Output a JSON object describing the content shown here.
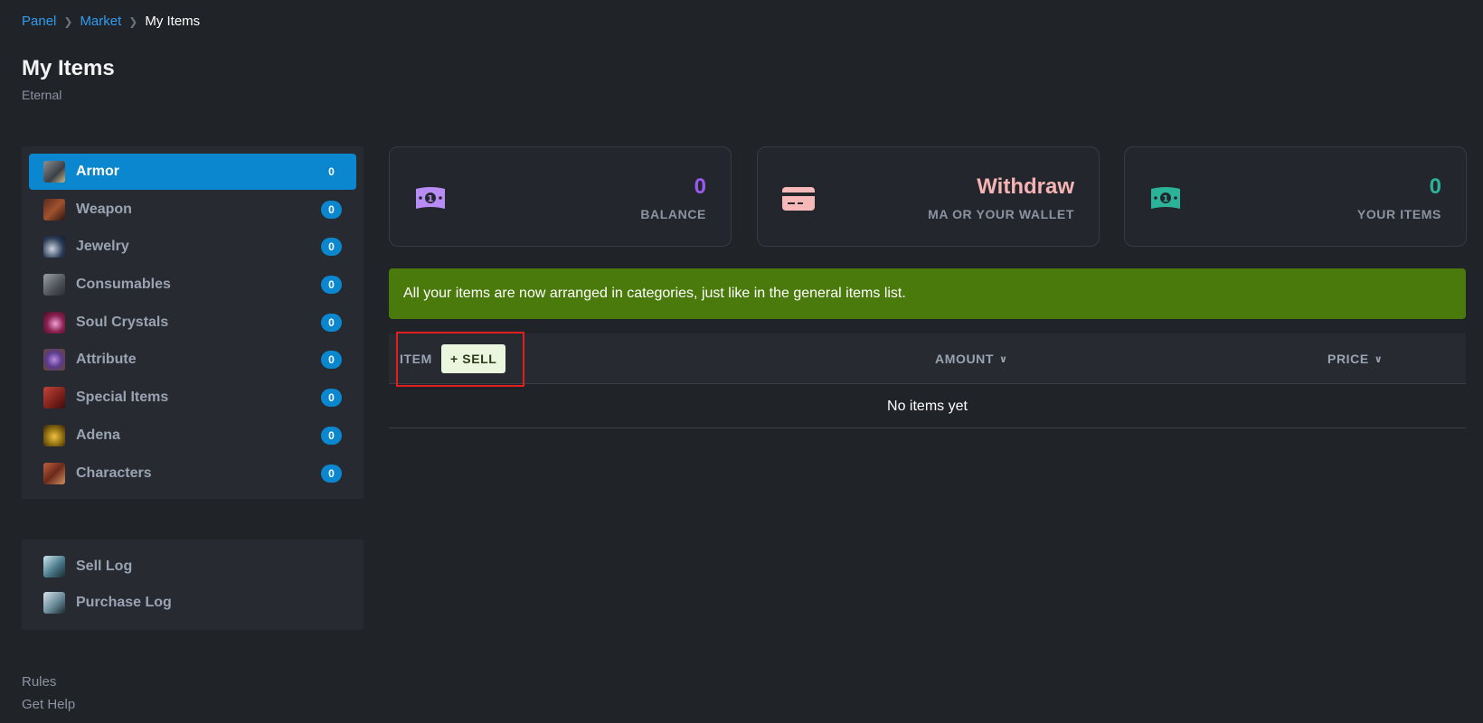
{
  "breadcrumb": {
    "items": [
      "Panel",
      "Market"
    ],
    "current": "My Items"
  },
  "page": {
    "title": "My Items",
    "subtitle": "Eternal"
  },
  "categories": [
    {
      "label": "Armor",
      "count": "0",
      "icon": "armor-icon",
      "active": true
    },
    {
      "label": "Weapon",
      "count": "0",
      "icon": "weapon-icon"
    },
    {
      "label": "Jewelry",
      "count": "0",
      "icon": "jewelry-icon"
    },
    {
      "label": "Consumables",
      "count": "0",
      "icon": "consumables-icon"
    },
    {
      "label": "Soul Crystals",
      "count": "0",
      "icon": "soul-crystal-icon"
    },
    {
      "label": "Attribute",
      "count": "0",
      "icon": "attribute-icon"
    },
    {
      "label": "Special Items",
      "count": "0",
      "icon": "special-items-icon"
    },
    {
      "label": "Adena",
      "count": "0",
      "icon": "adena-icon"
    },
    {
      "label": "Characters",
      "count": "0",
      "icon": "characters-icon"
    }
  ],
  "logs": [
    {
      "label": "Sell Log",
      "icon": "sell-log-icon"
    },
    {
      "label": "Purchase Log",
      "icon": "purchase-log-icon"
    }
  ],
  "footer": {
    "rules": "Rules",
    "help": "Get Help"
  },
  "cards": {
    "balance": {
      "value": "0",
      "label": "BALANCE",
      "color": "#9b59f0",
      "icon": "money-icon"
    },
    "withdraw": {
      "value": "Withdraw",
      "label": "MA OR YOUR WALLET",
      "color": "#f5b3b3",
      "icon": "credit-card-icon"
    },
    "items": {
      "value": "0",
      "label": "YOUR ITEMS",
      "color": "#2bb39a",
      "icon": "money-icon"
    }
  },
  "alert": "All your items are now arranged in categories, just like in the general items list.",
  "table": {
    "col_item": "ITEM",
    "sell_button": "+ SELL",
    "col_amount": "AMOUNT",
    "col_price": "PRICE",
    "empty": "No items yet"
  },
  "colors": {
    "accent": "#0a87cf",
    "success": "#4a7a0c",
    "link": "#2f9cf0"
  }
}
